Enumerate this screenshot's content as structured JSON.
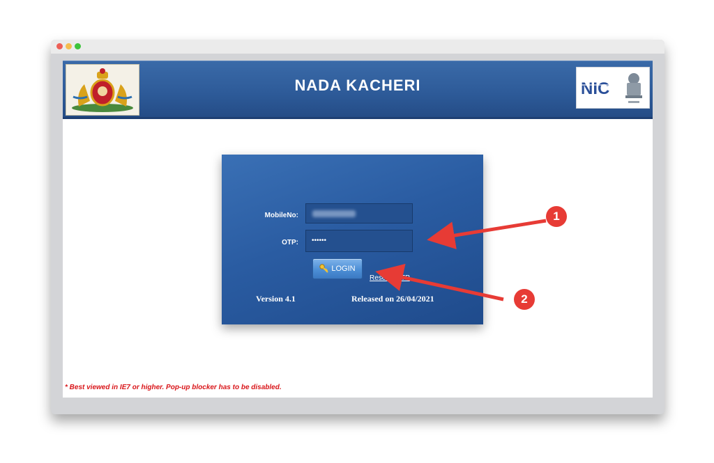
{
  "header": {
    "title": "NADA KACHERI",
    "left_logo": "karnataka-emblem-icon",
    "right_logo": "nic-logo-icon"
  },
  "login": {
    "mobile_label": "MobileNo:",
    "mobile_value": "",
    "otp_label": "OTP:",
    "otp_value": "••••••",
    "login_button": "LOGIN",
    "resend_link": "Resend OTP",
    "version": "Version 4.1",
    "released": "Released on 26/04/2021"
  },
  "footer": {
    "note": "* Best viewed in IE7 or higher. Pop-up blocker has to be disabled."
  },
  "annotations": [
    {
      "label": "1",
      "target": "otp-field"
    },
    {
      "label": "2",
      "target": "login-button"
    }
  ],
  "colors": {
    "header_blue": "#2d5a98",
    "panel_blue": "#2a5ca2",
    "annotation_red": "#e73b35",
    "note_red": "#d9161a"
  }
}
